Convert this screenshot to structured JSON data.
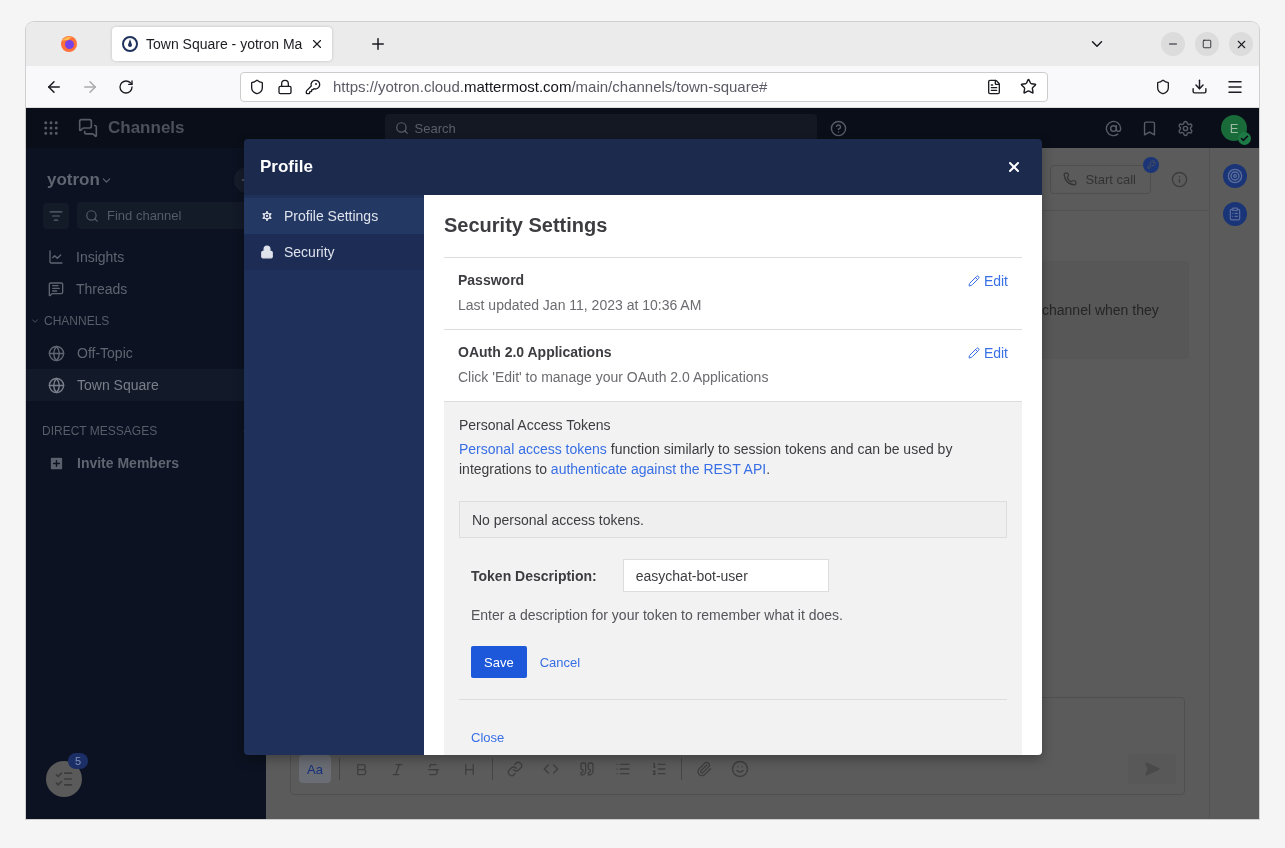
{
  "browser": {
    "tabs": [
      {
        "title": "Town Square - yotron Ma",
        "selected": true
      }
    ],
    "url": {
      "scheme_host": "https://yotron.cloud.",
      "domain": "mattermost.com",
      "path": "/main/channels/town-square#"
    }
  },
  "app_header": {
    "title": "Channels",
    "search_placeholder": "Search",
    "avatar_initial": "E"
  },
  "sidebar": {
    "team": "yotron",
    "find_placeholder": "Find channel",
    "items": [
      {
        "label": "Insights"
      },
      {
        "label": "Threads"
      }
    ],
    "channels_heading": "CHANNELS",
    "channels": [
      {
        "name": "Off-Topic",
        "selected": false
      },
      {
        "name": "Town Square",
        "selected": true
      }
    ],
    "dm_heading": "DIRECT MESSAGES",
    "invite": "Invite Members",
    "review_count": "5"
  },
  "channel": {
    "call_button": "Start call",
    "message_fragment": "channel when they",
    "format_label": "Aa"
  },
  "modal": {
    "title": "Profile",
    "nav": [
      {
        "label": "Profile Settings",
        "selected": false
      },
      {
        "label": "Security",
        "selected": true
      }
    ],
    "heading": "Security Settings",
    "sections": [
      {
        "title": "Password",
        "description": "Last updated Jan 11, 2023 at 10:36 AM",
        "action": "Edit"
      },
      {
        "title": "OAuth 2.0 Applications",
        "description": "Click 'Edit' to manage your OAuth 2.0 Applications",
        "action": "Edit"
      }
    ],
    "tokens": {
      "title": "Personal Access Tokens",
      "intro": [
        {
          "kind": "link",
          "text": "Personal access tokens"
        },
        {
          "kind": "text",
          "text": " function similarly to session tokens and can be used by integrations to "
        },
        {
          "kind": "link",
          "text": "authenticate against the REST API"
        },
        {
          "kind": "text",
          "text": "."
        }
      ],
      "empty": "No personal access tokens.",
      "field_label": "Token Description:",
      "field_value": "easychat-bot-user",
      "help": "Enter a description for your token to remember what it does.",
      "save": "Save",
      "cancel": "Cancel",
      "close": "Close"
    }
  }
}
